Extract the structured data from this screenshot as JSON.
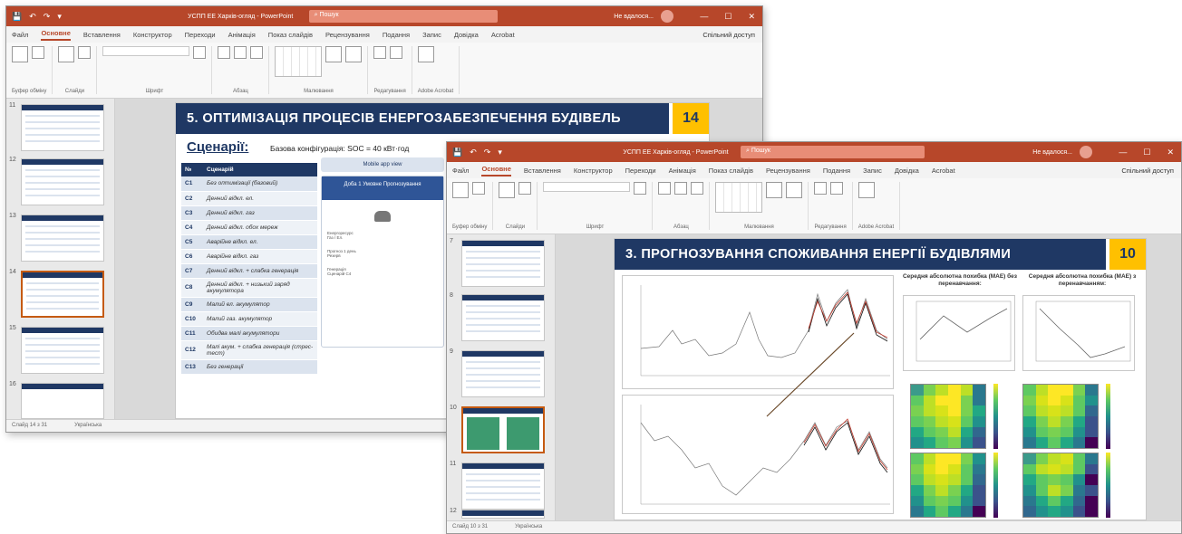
{
  "window_a": {
    "titlebar": {
      "quick_access": [
        "💾",
        "↶",
        "↷",
        "▾"
      ],
      "doc_title": "УСПП ЕЕ Харків-огляд - PowerPoint",
      "search": "Пошук",
      "warning": "Не вдалося...",
      "controls": [
        "—",
        "☐",
        "✕"
      ]
    },
    "tabs": [
      "Файл",
      "Основне",
      "Вставлення",
      "Конструктор",
      "Переходи",
      "Анімація",
      "Показ слайдів",
      "Рецензування",
      "Подання",
      "Запис",
      "Довідка",
      "Acrobat"
    ],
    "active_tab": "Основне",
    "share": "Спільний доступ",
    "ribbon_groups": [
      "Буфер обміну",
      "Слайди",
      "Шрифт",
      "Абзац",
      "Малювання",
      "Редагування",
      "Adobe Acrobat"
    ],
    "thumb_numbers": [
      "11",
      "12",
      "13",
      "14",
      "15",
      "16"
    ],
    "status": [
      "Слайд 14 з 31",
      "Українська"
    ],
    "slide": {
      "title": "5. ОПТИМІЗАЦІЯ ПРОЦЕСІВ ЕНЕРГОЗАБЕЗПЕЧЕННЯ БУДІВЕЛЬ",
      "number": "14",
      "scenarios_heading": "Сценарії:",
      "base_config": "Базова конфігурація: SOC = 40 кВт·год",
      "table_headers": [
        "№",
        "Сценарій"
      ],
      "rows": [
        {
          "code": "C1",
          "desc": "Без оптимізації (базовий)"
        },
        {
          "code": "C2",
          "desc": "Денний відкл. ел."
        },
        {
          "code": "C3",
          "desc": "Денний відкл. газ"
        },
        {
          "code": "C4",
          "desc": "Денний відкл. обох мереж"
        },
        {
          "code": "C5",
          "desc": "Аварійне відкл. ел."
        },
        {
          "code": "C6",
          "desc": "Аварійне відкл. газ"
        },
        {
          "code": "C7",
          "desc": "Денний відкл. + слабка генерація"
        },
        {
          "code": "C8",
          "desc": "Денний відкл. + низький заряд акумулятора"
        },
        {
          "code": "C9",
          "desc": "Малий ел. акумулятор"
        },
        {
          "code": "C10",
          "desc": "Малий газ. акумулятор"
        },
        {
          "code": "C11",
          "desc": "Обидва малі акумулятори"
        },
        {
          "code": "C12",
          "desc": "Малі акум. + слабка генерація (стрес-тест)"
        },
        {
          "code": "C13",
          "desc": "Без генерації"
        }
      ],
      "mobile_button": "Mobile app view",
      "mobile_card_title": "Доба 1 Умовне Прогнозування",
      "mobile_lines": [
        "Енергоресурс",
        "Газ / Ел.",
        "Прогноз 1 день",
        "Резерв",
        "Генерація",
        "Сценарій С4"
      ]
    }
  },
  "window_b": {
    "titlebar": {
      "quick_access": [
        "💾",
        "↶",
        "↷",
        "▾"
      ],
      "doc_title": "УСПП ЕЕ Харків-огляд - PowerPoint",
      "search": "Пошук",
      "warning": "Не вдалося...",
      "controls": [
        "—",
        "☐",
        "✕"
      ]
    },
    "tabs": [
      "Файл",
      "Основне",
      "Вставлення",
      "Конструктор",
      "Переходи",
      "Анімація",
      "Показ слайдів",
      "Рецензування",
      "Подання",
      "Запис",
      "Довідка",
      "Acrobat"
    ],
    "active_tab": "Основне",
    "share": "Спільний доступ",
    "ribbon_groups": [
      "Буфер обміну",
      "Слайди",
      "Шрифт",
      "Абзац",
      "Малювання",
      "Редагування",
      "Adobe Acrobat"
    ],
    "thumb_numbers": [
      "7",
      "8",
      "9",
      "10",
      "11",
      "12"
    ],
    "status": [
      "Слайд 10 з 31",
      "Українська"
    ],
    "slide": {
      "title": "3. ПРОГНОЗУВАННЯ СПОЖИВАННЯ ЕНЕРГІЇ БУДІВЛЯМИ",
      "number": "10",
      "mae_left_title": "Середня абсолютна похибка (MAE) без перенавчання:",
      "mae_right_title": "Середня абсолютна похибка (MAE) з перенавчанням:"
    }
  },
  "colors": {
    "titlebar": "#b7472a",
    "slide_title_bg": "#1f3864",
    "slide_number_bg": "#ffc000"
  }
}
